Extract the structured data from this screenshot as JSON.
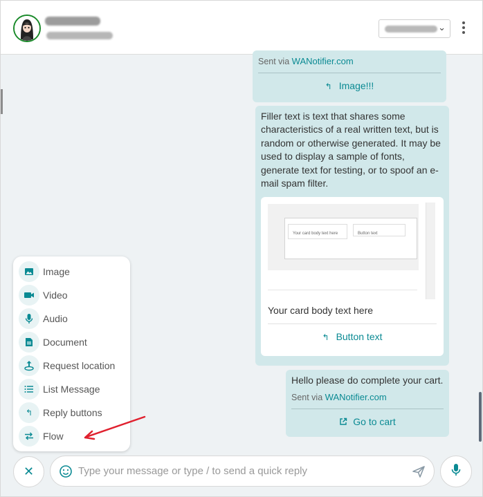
{
  "messages": {
    "m1": {
      "sent_prefix": "Sent via",
      "sent_link": "WANotifier.com",
      "button_label": "Image!!!"
    },
    "m2": {
      "text_lines": [
        "Filler text is text that shares some",
        "characteristics of a real written text, but is",
        "random or otherwise generated. It may be",
        "used to display a sample of fonts,",
        "generate text for testing, or to spoof an e-",
        "mail spam filter."
      ],
      "card_body": "Your card body text here",
      "card_button": "Button text",
      "card_preview_box1": "Your card body text here",
      "card_preview_box2": "Button text"
    },
    "m3": {
      "text": "Hello please do complete your cart.",
      "sent_prefix": "Sent via",
      "sent_link": "WANotifier.com",
      "button_label": "Go to cart"
    }
  },
  "attach_menu": {
    "items": [
      {
        "label": "Image",
        "icon": "image-icon"
      },
      {
        "label": "Video",
        "icon": "video-icon"
      },
      {
        "label": "Audio",
        "icon": "mic-icon"
      },
      {
        "label": "Document",
        "icon": "document-icon"
      },
      {
        "label": "Request location",
        "icon": "location-request-icon"
      },
      {
        "label": "List Message",
        "icon": "list-icon"
      },
      {
        "label": "Reply buttons",
        "icon": "reply-icon"
      },
      {
        "label": "Flow",
        "icon": "flow-icon"
      }
    ]
  },
  "composer": {
    "placeholder": "Type your message or type / to send a quick reply"
  },
  "colors": {
    "accent": "#0a8a93",
    "bubble": "#d1e8ea",
    "arrow": "#e0202e",
    "avatar_ring": "#1a8a2a"
  }
}
